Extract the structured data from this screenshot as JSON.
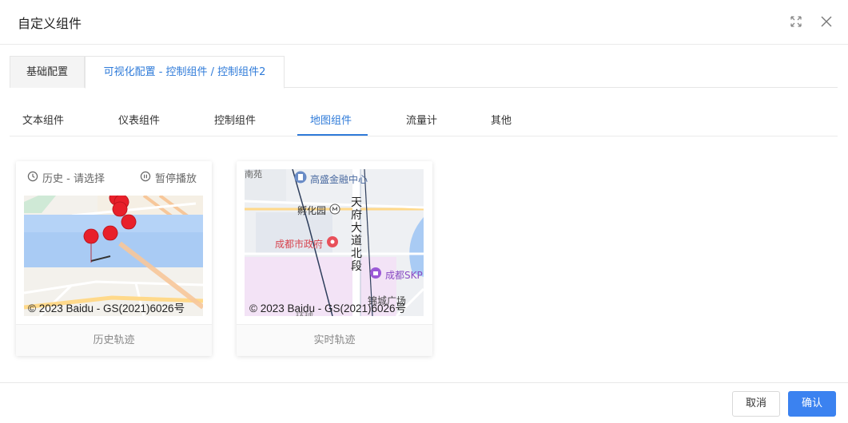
{
  "dialog": {
    "title": "自定义组件"
  },
  "top_tabs": [
    {
      "label": "基础配置",
      "active": false
    },
    {
      "label": "可视化配置 - 控制组件 / 控制组件2",
      "active": true
    }
  ],
  "component_tabs": [
    {
      "label": "文本组件"
    },
    {
      "label": "仪表组件"
    },
    {
      "label": "控制组件"
    },
    {
      "label": "地图组件",
      "active": true
    },
    {
      "label": "流量计"
    },
    {
      "label": "其他"
    }
  ],
  "cards": [
    {
      "history_label": "历史 - 请选择",
      "pause_label": "暂停播放",
      "copyright": "© 2023 Baidu - GS(2021)6026号",
      "caption": "历史轨迹"
    },
    {
      "map_labels": {
        "top_partial": "南苑",
        "finance_center": "高盛金融中心",
        "incubator": "孵化园",
        "road_name": "天府大道北段",
        "city_gov": "成都市政府",
        "skp": "成都SKP",
        "plaza_partial": "锦城广场",
        "bottom_partial": "环球"
      },
      "copyright": "© 2023 Baidu - GS(2021)6026号",
      "caption": "实时轨迹"
    }
  ],
  "footer": {
    "cancel_label": "取消",
    "confirm_label": "确认"
  },
  "colors": {
    "accent": "#2f7bd9",
    "primary_button": "#3b82f0",
    "marker": "#e8202a"
  },
  "icons": [
    "expand-icon",
    "close-icon",
    "clock-icon",
    "pause-icon",
    "poi-building-icon",
    "metro-icon",
    "gov-pin-icon",
    "shop-pin-icon"
  ]
}
